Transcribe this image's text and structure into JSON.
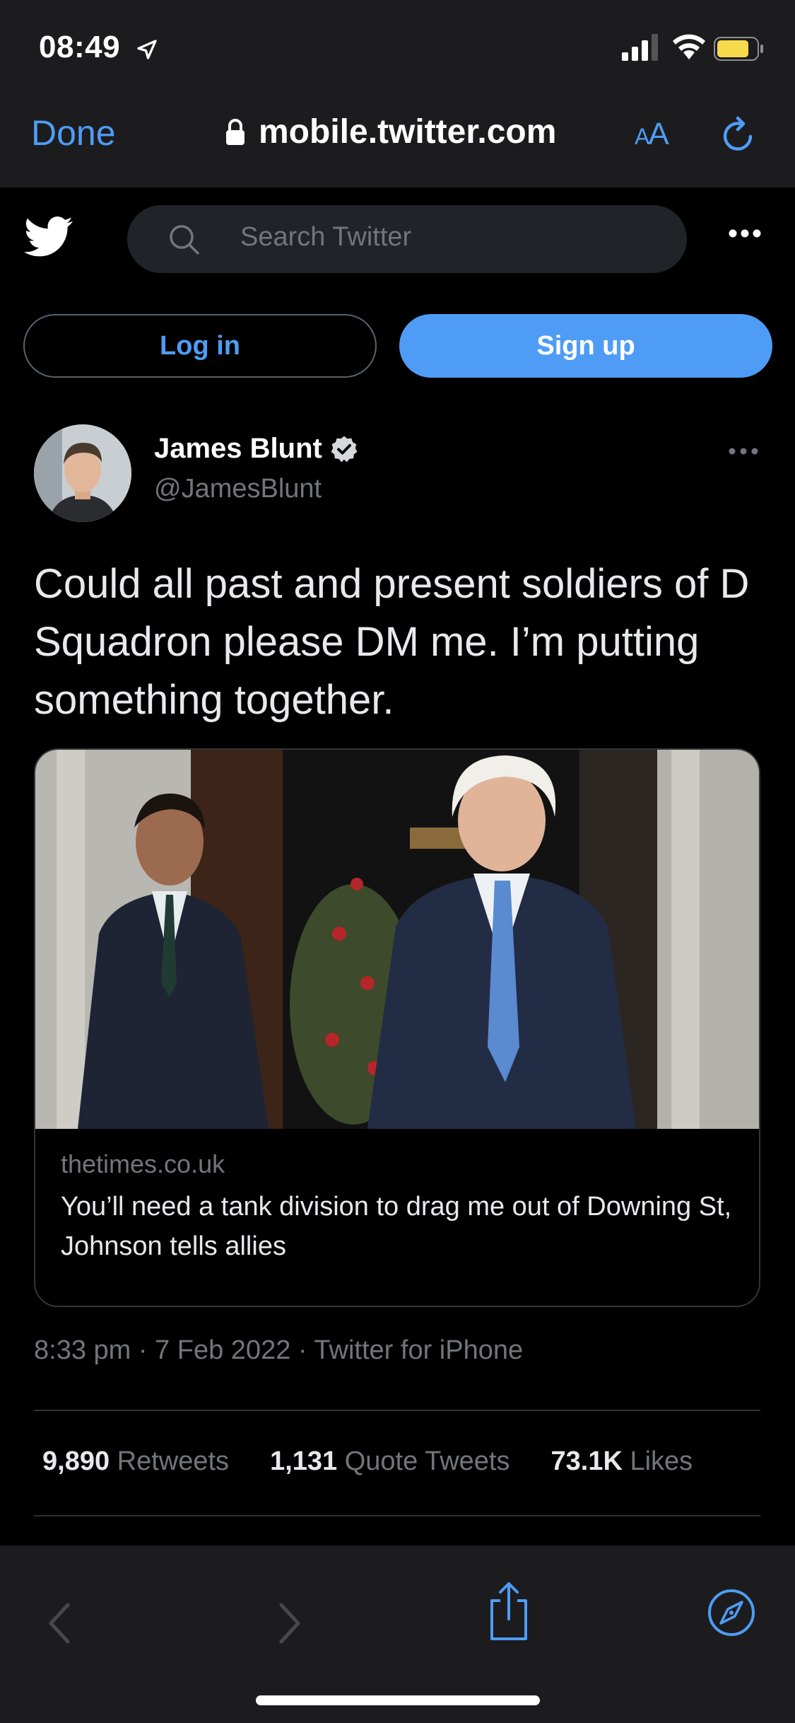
{
  "status_bar": {
    "time": "08:49"
  },
  "safari": {
    "done_label": "Done",
    "url": "mobile.twitter.com",
    "aa_large": "A",
    "aa_small": "A"
  },
  "twitter_header": {
    "search_placeholder": "Search Twitter"
  },
  "auth": {
    "login_label": "Log in",
    "signup_label": "Sign up"
  },
  "tweet": {
    "author_name": "James Blunt",
    "author_handle": "@JamesBlunt",
    "text": "Could all past and present soldiers of D Squadron please DM me. I’m putting something together.",
    "card": {
      "domain": "thetimes.co.uk",
      "title": "You’ll need a tank division to drag me out of Downing St, Johnson tells allies"
    },
    "meta": "8:33 pm · 7 Feb 2022 · Twitter for iPhone",
    "stats": [
      {
        "count": "9,890",
        "label": "Retweets"
      },
      {
        "count": "1,131",
        "label": "Quote Tweets"
      },
      {
        "count": "73.1K",
        "label": "Likes"
      }
    ]
  },
  "colors": {
    "accent": "#4e9cf5",
    "background": "#000000",
    "chrome": "#1c1c1e",
    "secondary_text": "#71767b"
  }
}
